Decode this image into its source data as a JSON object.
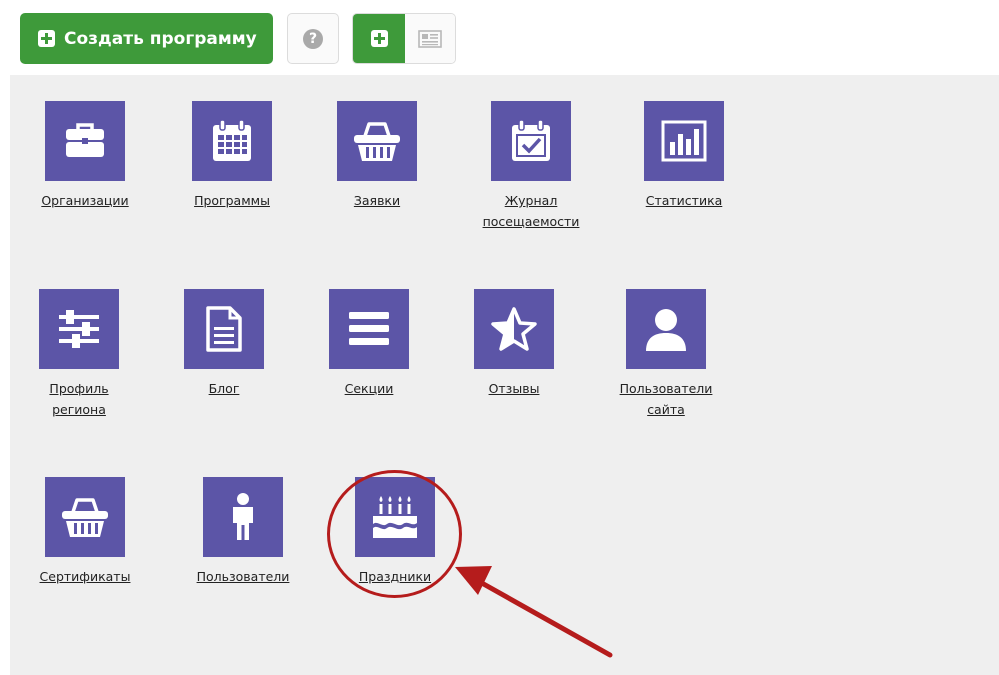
{
  "toolbar": {
    "create_label": "Создать программу",
    "help_icon": "question-circle-icon",
    "help_glyph": "?",
    "add_icon": "plus-square-icon",
    "list_icon": "list-view-icon"
  },
  "tiles": [
    {
      "label": "Организации",
      "icon": "briefcase-icon"
    },
    {
      "label": "Программы",
      "icon": "calendar-icon"
    },
    {
      "label": "Заявки",
      "icon": "basket-icon"
    },
    {
      "label": "Журнал\nпосещаемости",
      "icon": "calendar-check-icon"
    },
    {
      "label": "Статистика",
      "icon": "bar-chart-icon"
    },
    {
      "label": "Профиль\nрегиона",
      "icon": "sliders-icon"
    },
    {
      "label": "Блог",
      "icon": "document-icon"
    },
    {
      "label": "Секции",
      "icon": "list-icon"
    },
    {
      "label": "Отзывы",
      "icon": "star-half-icon"
    },
    {
      "label": "Пользователи\nсайта",
      "icon": "user-icon"
    },
    {
      "label": "Сертификаты",
      "icon": "basket-icon"
    },
    {
      "label": "Пользователи",
      "icon": "person-icon"
    },
    {
      "label": "Праздники",
      "icon": "birthday-cake-icon"
    }
  ],
  "colors": {
    "green": "#3e9a3a",
    "tile": "#5c55a7",
    "panel": "#efefef",
    "highlight": "#b51c1c"
  }
}
